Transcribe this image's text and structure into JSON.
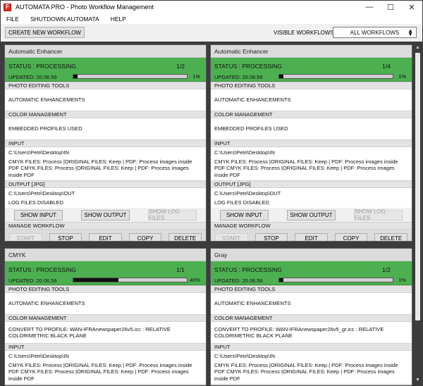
{
  "window": {
    "icon_letter": "F",
    "title": "AUTOMATA PRO - Photo Workflow Management",
    "minimize": "—",
    "maximize": "☐",
    "close": "✕"
  },
  "menu": [
    "FILE",
    "SHUTDOWN AUTOMATA",
    "HELP"
  ],
  "toolbar": {
    "create_label": "CREATE NEW WORKFLOW",
    "visible_label": "VISIBLE WORKFLOWS",
    "visible_value": "ALL WORKFLOWS"
  },
  "labels": {
    "status": "STATUS : PROCESSING",
    "updated": "UPDATED: 20.06.56",
    "photo_tools": "PHOTO EDITING TOOLS",
    "color_mgmt": "COLOR MANAGEMENT",
    "input": "INPUT",
    "output": "OUTPUT [JPG]",
    "show_input": "SHOW INPUT",
    "show_output": "SHOW OUTPUT",
    "show_log": "SHOW LOG FILES",
    "manage": "MANAGE WORKFLOW",
    "start": "START",
    "stop": "STOP",
    "edit": "EDIT",
    "copy": "COPY",
    "delete": "DELETE"
  },
  "panels": [
    {
      "title": "Automatic Enhancer",
      "count": "1/2",
      "percent": "1%",
      "progress": 0.04,
      "photo_tools": "AUTOMATIC ENHANCEMENTS",
      "color_mgmt": "EMBEDDED PROFILES USED",
      "input_path": "C:\\Users\\Petri\\Desktop\\IN",
      "input_files": "CMYK FILES: Process |ORIGINAL FILES: Keep | PDF: Process images inside PDF CMYK FILES: Process |ORIGINAL FILES: Keep | PDF: Process images inside PDF",
      "output_path": "C:\\Users\\Petri\\Desktop\\OUT",
      "log": "LOG FILES DISABLED"
    },
    {
      "title": "Automatic Enhancer",
      "count": "1/4",
      "percent": "1%",
      "progress": 0.04,
      "photo_tools": "AUTOMATIC ENHANCEMENTS",
      "color_mgmt": "EMBEDDED PROFILES USED",
      "input_path": "C:\\Users\\Petri\\Desktop\\IN",
      "input_files": "CMYK FILES: Process |ORIGINAL FILES: Keep | PDF: Process images inside PDF CMYK FILES: Process |ORIGINAL FILES: Keep | PDF: Process images inside PDF",
      "output_path": "C:\\Users\\Petri\\Desktop\\OUT",
      "log": "LOG FILES DISABLED"
    },
    {
      "title": "CMYK",
      "count": "1/1",
      "percent": "40%",
      "progress": 0.4,
      "photo_tools": "AUTOMATIC ENHANCEMENTS",
      "color_mgmt": "CONVERT TO PROFILE: WAN-IFRAnewspaper26v5.icc : RELATIVE COLORIMETRIC BLACK PLANE",
      "input_path": "C:\\Users\\Petri\\Desktop\\IN",
      "input_files": "CMYK FILES: Process |ORIGINAL FILES: Keep | PDF: Process images inside PDF CMYK FILES: Process |ORIGINAL FILES: Keep | PDF: Process images inside PDF"
    },
    {
      "title": "Gray",
      "count": "1/2",
      "percent": "1%",
      "progress": 0.04,
      "photo_tools": "AUTOMATIC ENHANCEMENTS",
      "color_mgmt": "CONVERT TO PROFILE: WAN-IFRAnewspaper26v5_gr.icc : RELATIVE COLORIMETRIC BLACK PLANE",
      "input_path": "C:\\Users\\Petri\\Desktop\\IN",
      "input_files": "CMYK FILES: Process |ORIGINAL FILES: Keep | PDF: Process images inside PDF CMYK FILES: Process |ORIGINAL FILES: Keep | PDF: Process images inside PDF"
    }
  ],
  "colors": {
    "status_green": "#4cb050",
    "background_dark": "#3c3c3c"
  }
}
